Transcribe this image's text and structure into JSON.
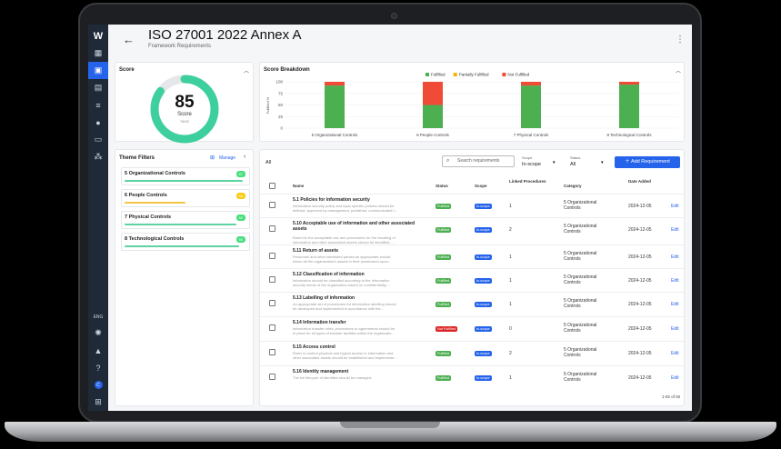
{
  "page": {
    "title": "ISO 27001 2022 Annex A",
    "subtitle": "Framework Requirements"
  },
  "sidebar": {
    "logo": "W",
    "lang": "ENG",
    "avatar": "C"
  },
  "score": {
    "title": "Score",
    "value": "85",
    "label": "Score",
    "sub": "78/92",
    "fraction": 0.85
  },
  "breakdown": {
    "title": "Score Breakdown"
  },
  "chart_data": {
    "type": "bar",
    "title": "Score Breakdown",
    "ylabel": "Fulfilled %",
    "ylim": [
      0,
      100
    ],
    "yticks": [
      "0",
      "25",
      "50",
      "75",
      "100"
    ],
    "categories": [
      "5 Organizational Controls",
      "6 People Controls",
      "7 Physical Controls",
      "8 Technological Controls"
    ],
    "series": [
      {
        "name": "Fulfilled",
        "color": "#4caf50",
        "values": [
          92,
          50,
          92,
          94
        ]
      },
      {
        "name": "Partially Fulfilled",
        "color": "#f4b400",
        "values": [
          0,
          0,
          0,
          0
        ]
      },
      {
        "name": "Not Fulfilled",
        "color": "#ef4b37",
        "values": [
          8,
          50,
          8,
          6
        ]
      }
    ],
    "legend_position": "top-center",
    "stacked": true
  },
  "theme_filters": {
    "title": "Theme Filters",
    "manage": "Manage",
    "items": [
      {
        "name": "5 Organizational Controls",
        "badge": "97",
        "color": "#4ade80",
        "bar": "#5fd3a1"
      },
      {
        "name": "6 People Controls",
        "badge": "50",
        "color": "#facc15",
        "bar": "#f4c542"
      },
      {
        "name": "7 Physical Controls",
        "badge": "92",
        "color": "#4ade80",
        "bar": "#5fd3a1"
      },
      {
        "name": "8 Technological Controls",
        "badge": "94",
        "color": "#4ade80",
        "bar": "#5fd3a1"
      }
    ]
  },
  "table": {
    "all_label": "All",
    "search_placeholder": "Search requirements",
    "scope_label": "Scope",
    "scope_value": "In-scope",
    "status_label": "Status",
    "status_value": "All",
    "add_button": "Add Requirement",
    "headers": {
      "name": "Name",
      "status": "Status",
      "scope": "Scope",
      "linked": "Linked Procedures",
      "category": "Category",
      "date": "Date Added"
    },
    "rows": [
      {
        "name": "5.1 Policies for information security",
        "desc1": "Information security policy and topic-specific policies should be",
        "desc2": "defined, approved by management, published, communicated t...",
        "status": "Fulfilled",
        "scope": "In-scope",
        "linked": "1",
        "category": "5 Organizational Controls",
        "date": "2024-12-05",
        "edit": "Edit"
      },
      {
        "name": "5.10 Acceptable use of information and other associated assets",
        "desc1": "Rules for the acceptable use and procedures for the handling of",
        "desc2": "information and other associated assets should be identified,...",
        "status": "Fulfilled",
        "scope": "In-scope",
        "linked": "2",
        "category": "5 Organizational Controls",
        "date": "2024-12-05",
        "edit": "Edit"
      },
      {
        "name": "5.11 Return of assets",
        "desc1": "Personnel and other interested parties as appropriate should",
        "desc2": "return all the organization's assets in their possession upon...",
        "status": "Fulfilled",
        "scope": "In-scope",
        "linked": "1",
        "category": "5 Organizational Controls",
        "date": "2024-12-05",
        "edit": "Edit"
      },
      {
        "name": "5.12 Classification of information",
        "desc1": "Information should be classified according to the information",
        "desc2": "security needs of the organization based on confidentiality,...",
        "status": "Fulfilled",
        "scope": "In-scope",
        "linked": "1",
        "category": "5 Organizational Controls",
        "date": "2024-12-05",
        "edit": "Edit"
      },
      {
        "name": "5.13 Labelling of information",
        "desc1": "An appropriate set of procedures for information labelling should",
        "desc2": "be developed and implemented in accordance with the...",
        "status": "Fulfilled",
        "scope": "In-scope",
        "linked": "1",
        "category": "5 Organizational Controls",
        "date": "2024-12-05",
        "edit": "Edit"
      },
      {
        "name": "5.14 Information transfer",
        "desc1": "Information transfer rules, procedures or agreements should be",
        "desc2": "in place for all types of transfer facilities within the organizatio...",
        "status": "Not Fulfilled",
        "scope": "In-scope",
        "linked": "0",
        "category": "5 Organizational Controls",
        "date": "2024-12-05",
        "edit": "Edit"
      },
      {
        "name": "5.15 Access control",
        "desc1": "Rules to control physical and logical access to information and",
        "desc2": "other associated assets should be established and implemente...",
        "status": "Fulfilled",
        "scope": "In-scope",
        "linked": "2",
        "category": "5 Organizational Controls",
        "date": "2024-12-05",
        "edit": "Edit"
      },
      {
        "name": "5.16 Identity management",
        "desc1": "The full lifecycle of identities should be managed.",
        "desc2": "",
        "status": "Fulfilled",
        "scope": "In-scope",
        "linked": "1",
        "category": "5 Organizational Controls",
        "date": "2024-12-05",
        "edit": "Edit"
      }
    ],
    "pagination": "1-92 of 92"
  },
  "colors": {
    "accent": "#2563eb",
    "fulfilled": "#4caf50",
    "not_fulfilled": "#dc2626",
    "scope": "#2563eb"
  }
}
